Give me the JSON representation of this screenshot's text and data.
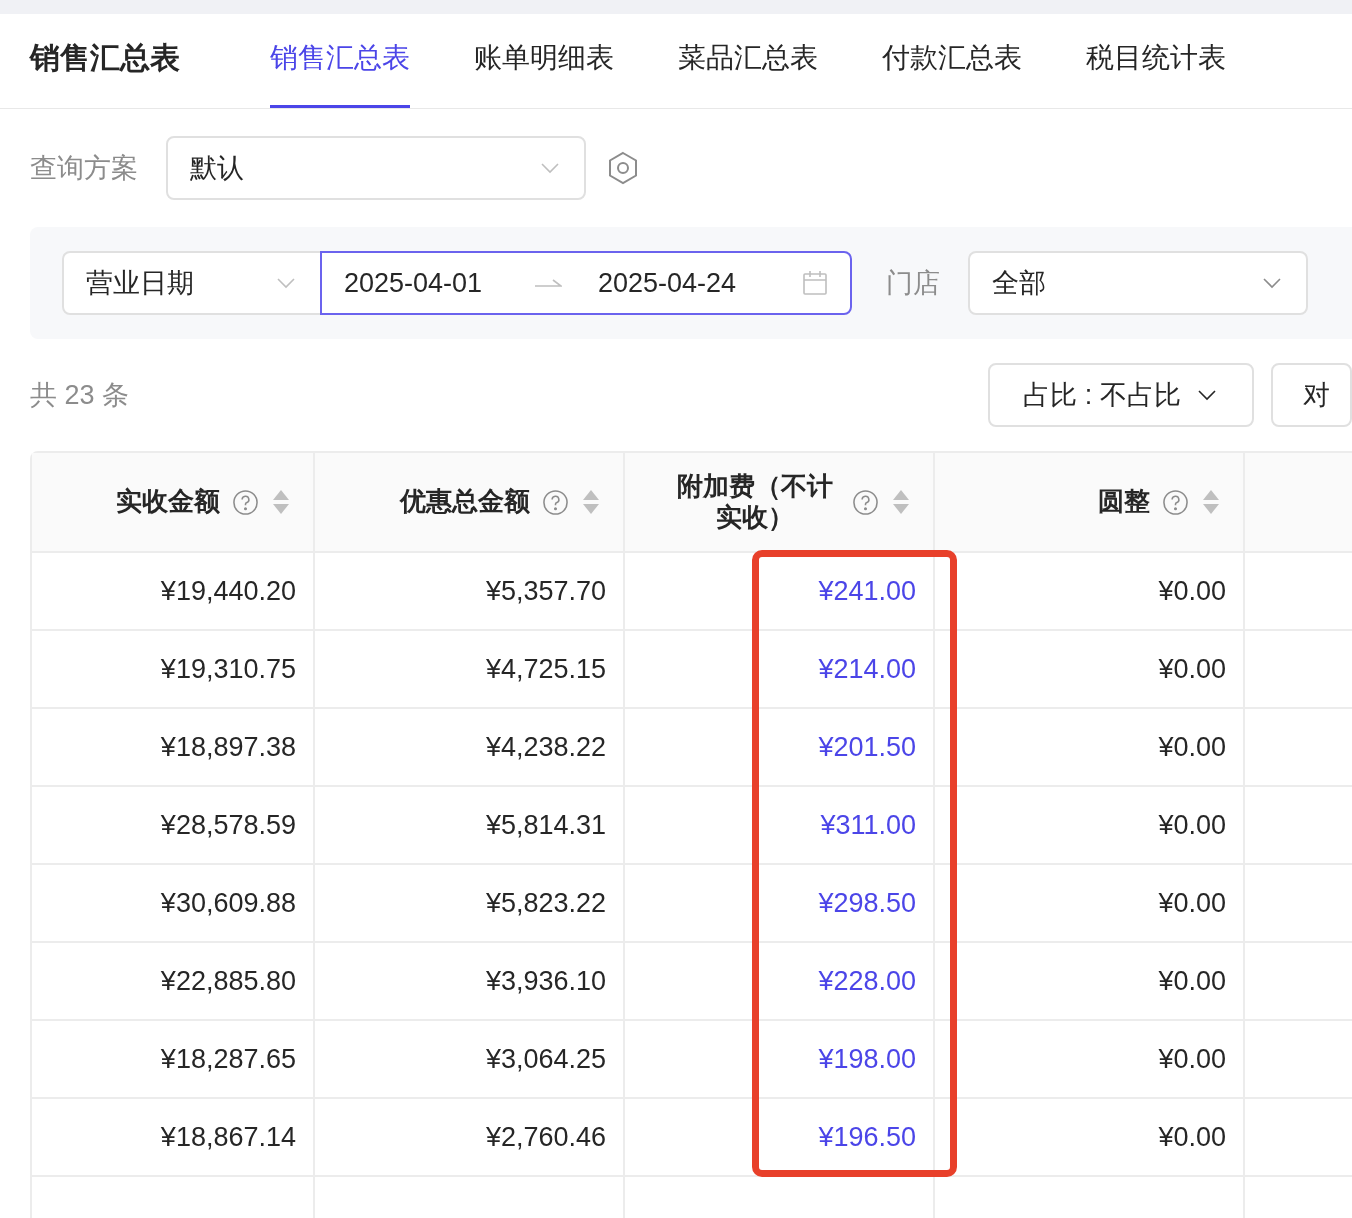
{
  "header": {
    "title": "销售汇总表",
    "tabs": [
      {
        "label": "销售汇总表",
        "selected": true
      },
      {
        "label": "账单明细表",
        "selected": false
      },
      {
        "label": "菜品汇总表",
        "selected": false
      },
      {
        "label": "付款汇总表",
        "selected": false
      },
      {
        "label": "税目统计表",
        "selected": false
      }
    ]
  },
  "query": {
    "label": "查询方案",
    "value": "默认"
  },
  "filters": {
    "date_type": "营业日期",
    "date_start": "2025-04-01",
    "date_end": "2025-04-24",
    "store_label": "门店",
    "store_value": "全部"
  },
  "summary": {
    "count": "共 23 条",
    "ratio_button": "占比 : 不占比",
    "compare_button": "对"
  },
  "table": {
    "columns": [
      {
        "label": "实收金额"
      },
      {
        "label": "优惠总金额"
      },
      {
        "label": "附加费（不计实收）"
      },
      {
        "label": "圆整"
      }
    ],
    "rows": [
      [
        "¥19,440.20",
        "¥5,357.70",
        "¥241.00",
        "¥0.00"
      ],
      [
        "¥19,310.75",
        "¥4,725.15",
        "¥214.00",
        "¥0.00"
      ],
      [
        "¥18,897.38",
        "¥4,238.22",
        "¥201.50",
        "¥0.00"
      ],
      [
        "¥28,578.59",
        "¥5,814.31",
        "¥311.00",
        "¥0.00"
      ],
      [
        "¥30,609.88",
        "¥5,823.22",
        "¥298.50",
        "¥0.00"
      ],
      [
        "¥22,885.80",
        "¥3,936.10",
        "¥228.00",
        "¥0.00"
      ],
      [
        "¥18,287.65",
        "¥3,064.25",
        "¥198.00",
        "¥0.00"
      ],
      [
        "¥18,867.14",
        "¥2,760.46",
        "¥196.50",
        "¥0.00"
      ]
    ]
  }
}
